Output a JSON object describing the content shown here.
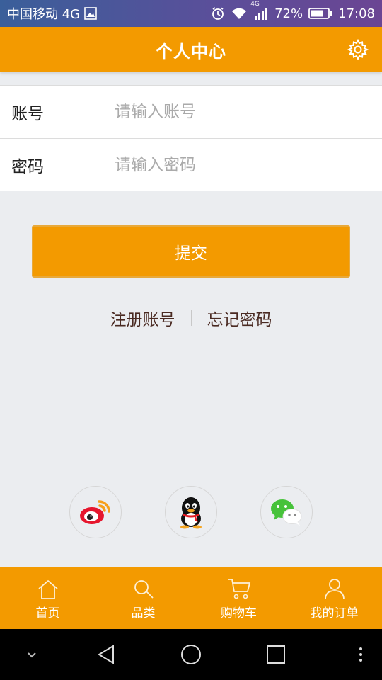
{
  "status_bar": {
    "carrier": "中国移动 4G",
    "network_badge": "4G",
    "battery": "72%",
    "time": "17:08"
  },
  "header": {
    "title": "个人中心",
    "settings_icon": "gear-icon"
  },
  "form": {
    "account_label": "账号",
    "account_placeholder": "请输入账号",
    "account_value": "",
    "password_label": "密码",
    "password_placeholder": "请输入密码",
    "password_value": ""
  },
  "submit_label": "提交",
  "links": {
    "register": "注册账号",
    "forgot": "忘记密码"
  },
  "social": [
    "weibo-icon",
    "qq-icon",
    "wechat-icon"
  ],
  "tabs": [
    {
      "label": "首页",
      "icon": "home-icon"
    },
    {
      "label": "品类",
      "icon": "search-icon"
    },
    {
      "label": "购物车",
      "icon": "cart-icon"
    },
    {
      "label": "我的订单",
      "icon": "user-icon"
    }
  ],
  "colors": {
    "accent": "#f39a00",
    "background": "#ebedf0",
    "link": "#4a2a22"
  }
}
